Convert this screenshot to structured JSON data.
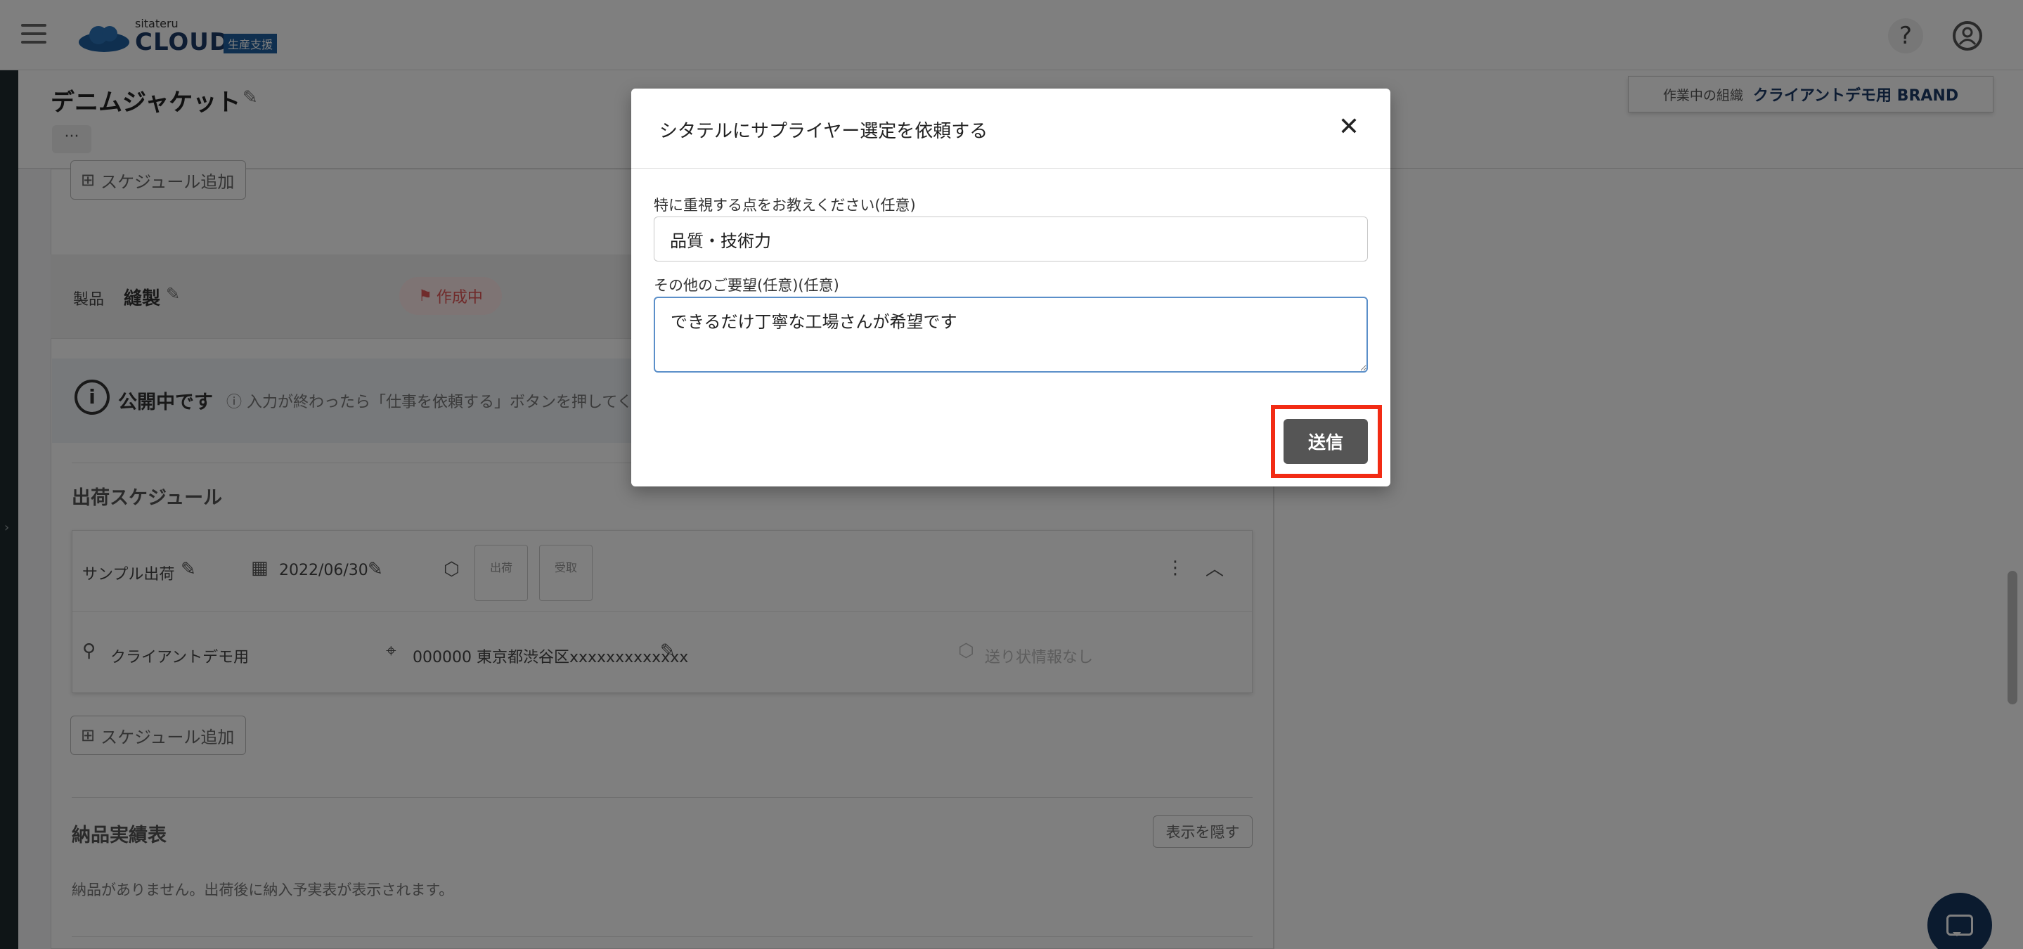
{
  "header": {
    "logo_small": "sitateru",
    "logo_big": "CLOUD",
    "logo_badge": "生産支援",
    "help_glyph": "?",
    "org_label": "作業中の組織",
    "org_name": "クライアントデモ用 BRAND"
  },
  "page": {
    "title": "デニムジャケット",
    "more_label": "···",
    "add_schedule_label": "スケジュール追加",
    "product_label": "製品",
    "product_name": "縫製",
    "status": "作成中",
    "public_title": "公開中です",
    "public_text": "入力が終わったら「仕事を依頼する」ボタンを押してく",
    "shipping_section_title": "出荷スケジュール",
    "shipping": {
      "name": "サンプル出荷",
      "date": "2022/06/30",
      "box1": "出荷",
      "box2": "受取",
      "recipient": "クライアントデモ用",
      "address": "000000 東京都渋谷区xxxxxxxxxxxxx",
      "tracking": "送り状情報なし"
    },
    "delivery_section_title": "納品実績表",
    "hide_label": "表示を隠す",
    "delivery_note": "納品がありません。出荷後に納入予実表が表示されます。"
  },
  "modal": {
    "title": "シタテルにサプライヤー選定を依頼する",
    "field1_label": "特に重視する点をお教えください(任意)",
    "field1_value": "品質・技術力",
    "field2_label": "その他のご要望(任意)(任意)",
    "field2_value": "できるだけ丁寧な工場さんが希望です",
    "submit_label": "送信",
    "close_glyph": "✕"
  },
  "colors": {
    "highlight": "#f22b14",
    "submit_bg": "#555555",
    "brand": "#1d3a66",
    "status": "#e15757"
  }
}
